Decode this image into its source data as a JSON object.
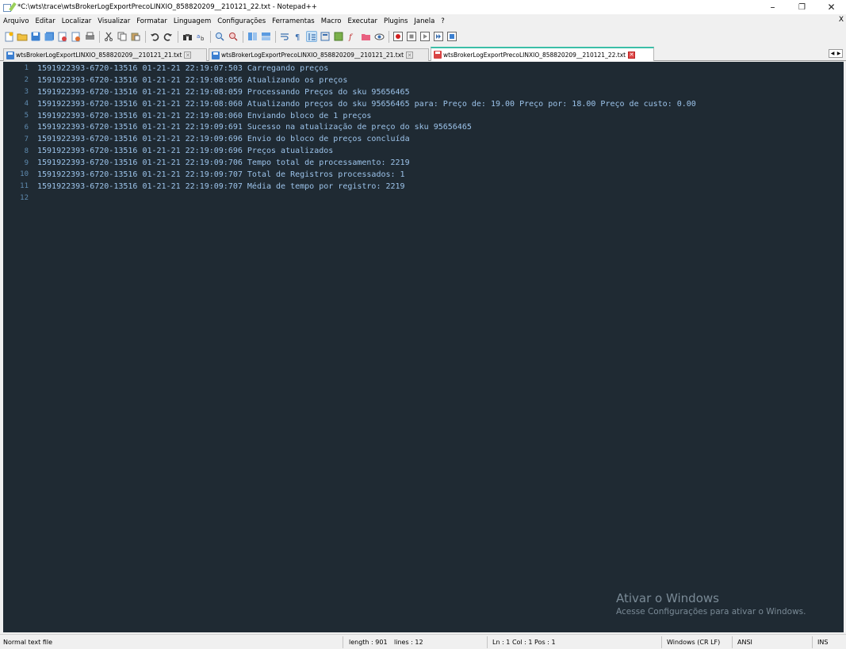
{
  "window": {
    "title": "*C:\\wts\\trace\\wtsBrokerLogExportPrecoLINXIO_858820209__210121_22.txt - Notepad++",
    "minimize": "–",
    "maximize": "❐",
    "close": "✕"
  },
  "menu": {
    "items": [
      "Arquivo",
      "Editar",
      "Localizar",
      "Visualizar",
      "Formatar",
      "Linguagem",
      "Configurações",
      "Ferramentas",
      "Macro",
      "Executar",
      "Plugins",
      "Janela",
      "?"
    ],
    "close_doc": "X"
  },
  "tabs": [
    {
      "label": "wtsBrokerLogExportLINXIO_858820209__210121_21.txt",
      "active": false,
      "icon_color": "#3c7fd0"
    },
    {
      "label": "wtsBrokerLogExportPrecoLINXIO_858820209__210121_21.txt",
      "active": false,
      "icon_color": "#3c7fd0"
    },
    {
      "label": "wtsBrokerLogExportPrecoLINXIO_858820209__210121_22.txt",
      "active": true,
      "icon_color": "#d94444"
    }
  ],
  "editor": {
    "line_numbers": [
      "1",
      "2",
      "3",
      "4",
      "5",
      "6",
      "7",
      "8",
      "9",
      "10",
      "11",
      "12"
    ],
    "lines": [
      "1591922393-6720-13516 01-21-21 22:19:07:503 Carregando preços",
      "1591922393-6720-13516 01-21-21 22:19:08:056 Atualizando os preços",
      "1591922393-6720-13516 01-21-21 22:19:08:059 Processando Preços do sku 95656465",
      "1591922393-6720-13516 01-21-21 22:19:08:060 Atualizando preços do sku 95656465 para: Preço de: 19.00 Preço por: 18.00 Preço de custo: 0.00",
      "1591922393-6720-13516 01-21-21 22:19:08:060 Enviando bloco de 1 preços",
      "1591922393-6720-13516 01-21-21 22:19:09:691 Sucesso na atualização de preço do sku 95656465",
      "1591922393-6720-13516 01-21-21 22:19:09:696 Envio do bloco de preços concluída",
      "1591922393-6720-13516 01-21-21 22:19:09:696 Preços atualizados",
      "1591922393-6720-13516 01-21-21 22:19:09:706 Tempo total de processamento: 2219",
      "1591922393-6720-13516 01-21-21 22:19:09:707 Total de Registros processados: 1",
      "1591922393-6720-13516 01-21-21 22:19:09:707 Média de tempo por registro: 2219",
      ""
    ],
    "background": "#1f2a33",
    "text_color": "#9cc3ea"
  },
  "watermark": {
    "title": "Ativar o Windows",
    "subtitle": "Acesse Configurações para ativar o Windows."
  },
  "status": {
    "file_type": "Normal text file",
    "length": "length : 901",
    "lines": "lines : 12",
    "position": "Ln : 1    Col : 1    Pos : 1",
    "eol": "Windows (CR LF)",
    "encoding": "ANSI",
    "mode": "INS"
  }
}
